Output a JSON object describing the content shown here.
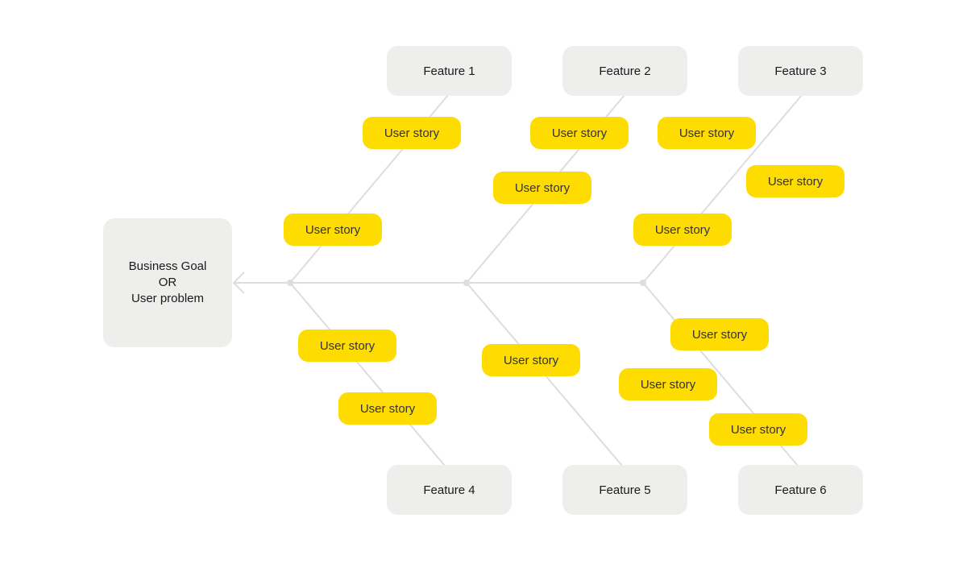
{
  "goal": {
    "line1": "Business Goal",
    "line2": "OR",
    "line3": "User problem"
  },
  "features": [
    "Feature 1",
    "Feature 2",
    "Feature 3",
    "Feature 4",
    "Feature 5",
    "Feature 6"
  ],
  "story_label": "User story",
  "stories": [
    {
      "label": "User story",
      "feature": "Feature 1"
    },
    {
      "label": "User story",
      "feature": "Feature 1"
    },
    {
      "label": "User story",
      "feature": "Feature 2"
    },
    {
      "label": "User story",
      "feature": "Feature 2"
    },
    {
      "label": "User story",
      "feature": "Feature 3"
    },
    {
      "label": "User story",
      "feature": "Feature 3"
    },
    {
      "label": "User story",
      "feature": "Feature 3"
    },
    {
      "label": "User story",
      "feature": "Feature 4"
    },
    {
      "label": "User story",
      "feature": "Feature 4"
    },
    {
      "label": "User story",
      "feature": "Feature 5"
    },
    {
      "label": "User story",
      "feature": "Feature 6"
    },
    {
      "label": "User story",
      "feature": "Feature 6"
    },
    {
      "label": "User story",
      "feature": "Feature 6"
    }
  ],
  "colors": {
    "story": "#ffdc00",
    "box": "#eeeeed",
    "line": "#dddddd"
  }
}
